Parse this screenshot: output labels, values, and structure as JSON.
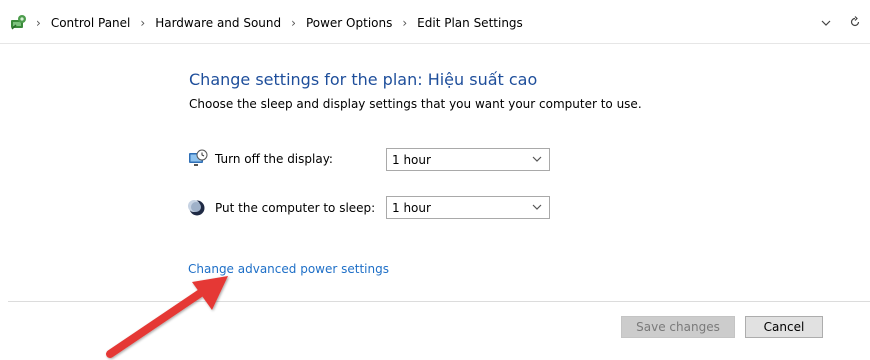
{
  "breadcrumb": {
    "items": [
      "Control Panel",
      "Hardware and Sound",
      "Power Options",
      "Edit Plan Settings"
    ]
  },
  "page": {
    "title": "Change settings for the plan: Hiệu suất cao",
    "subtitle": "Choose the sleep and display settings that you want your computer to use."
  },
  "settings": {
    "display": {
      "label": "Turn off the display:",
      "value": "1 hour"
    },
    "sleep": {
      "label": "Put the computer to sleep:",
      "value": "1 hour"
    }
  },
  "advanced_link": "Change advanced power settings",
  "buttons": {
    "save": "Save changes",
    "cancel": "Cancel"
  },
  "colors": {
    "title": "#1e4e9b",
    "link": "#1e6fc7",
    "arrow": "#e53935"
  }
}
